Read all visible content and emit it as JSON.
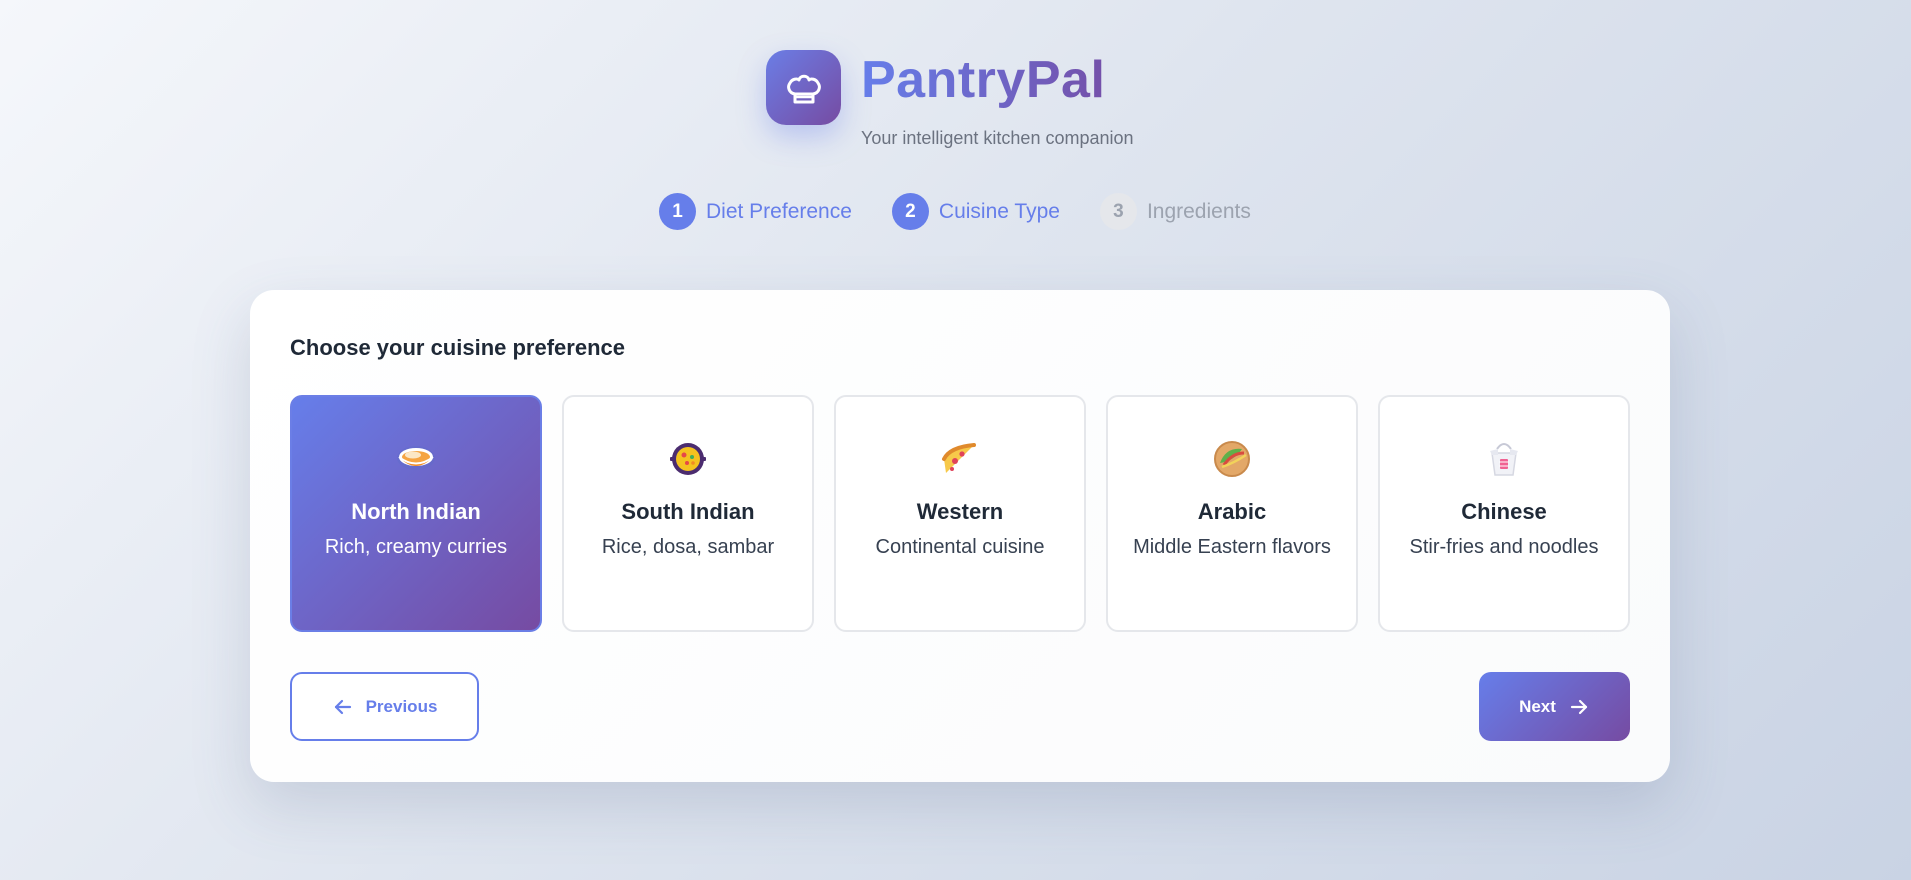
{
  "header": {
    "logo_icon": "chef-hat-icon",
    "title": "PantryPal",
    "subtitle": "Your intelligent kitchen companion"
  },
  "stepper": {
    "steps": [
      {
        "number": "1",
        "label": "Diet Preference",
        "state": "active"
      },
      {
        "number": "2",
        "label": "Cuisine Type",
        "state": "active"
      },
      {
        "number": "3",
        "label": "Ingredients",
        "state": "inactive"
      }
    ]
  },
  "card": {
    "heading": "Choose your cuisine preference",
    "options": [
      {
        "icon": "curry-bowl-icon",
        "title": "North Indian",
        "description": "Rich, creamy curries",
        "selected": true
      },
      {
        "icon": "paella-pan-icon",
        "title": "South Indian",
        "description": "Rice, dosa, sambar",
        "selected": false
      },
      {
        "icon": "pizza-slice-icon",
        "title": "Western",
        "description": "Continental cuisine",
        "selected": false
      },
      {
        "icon": "taco-icon",
        "title": "Arabic",
        "description": "Middle Eastern flavors",
        "selected": false
      },
      {
        "icon": "takeout-box-icon",
        "title": "Chinese",
        "description": "Stir-fries and noodles",
        "selected": false
      }
    ],
    "previous_label": "Previous",
    "next_label": "Next"
  },
  "colors": {
    "accent": "#667eea",
    "accent_dark": "#764ba2",
    "inactive": "#9ca3af"
  }
}
